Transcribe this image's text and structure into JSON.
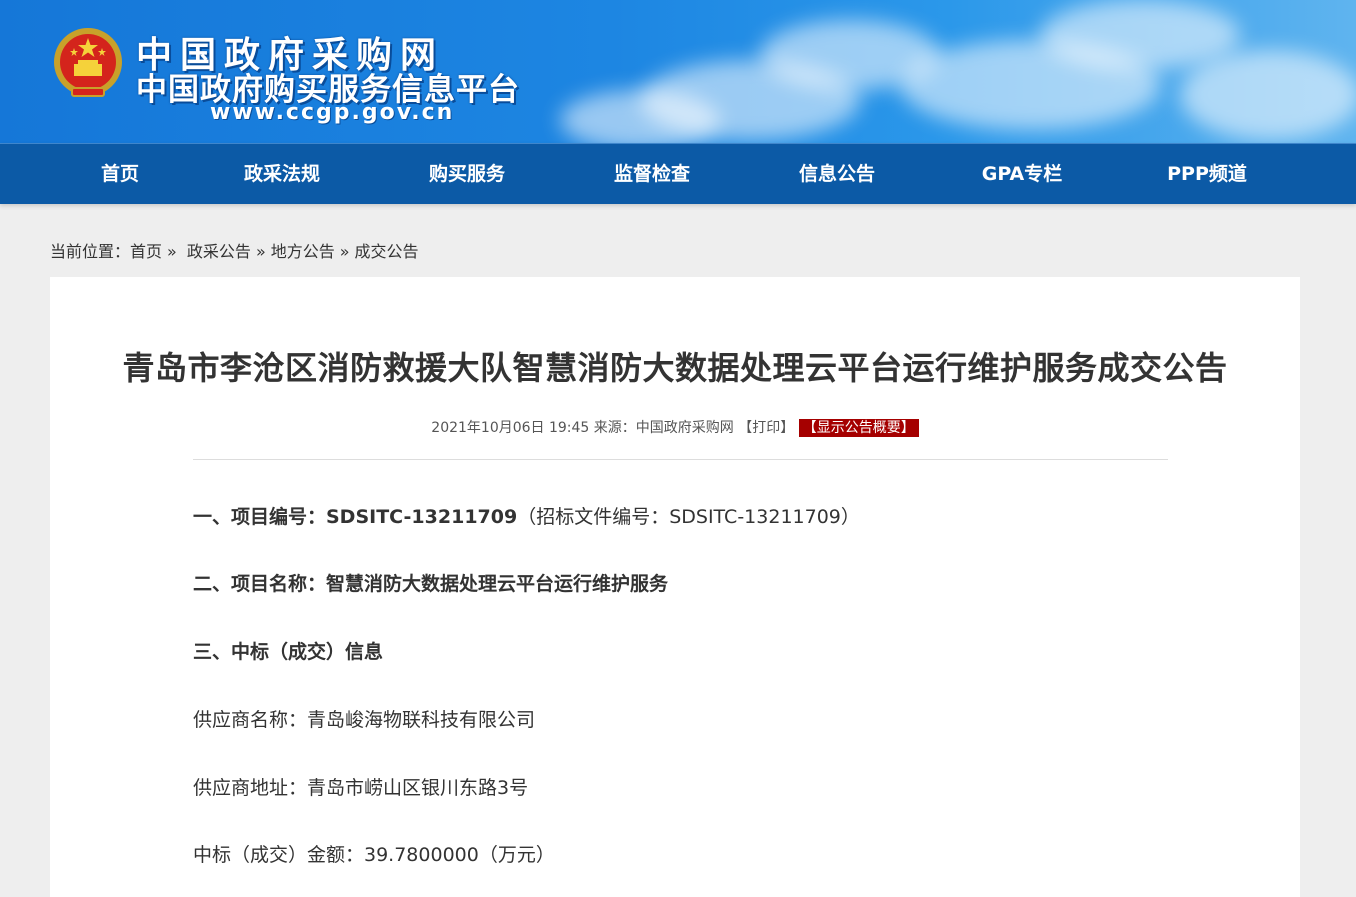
{
  "header": {
    "brand_line1": "中国政府采购网",
    "brand_line2": "中国政府购买服务信息平台",
    "brand_url": "www.ccgp.gov.cn",
    "emblem_icon": "national-emblem-icon",
    "colors": {
      "header_blue": "#1d86e2",
      "nav_blue": "#0c5aa6",
      "summary_red": "#a50000"
    }
  },
  "nav": {
    "items": [
      {
        "label": "首页"
      },
      {
        "label": "政采法规"
      },
      {
        "label": "购买服务"
      },
      {
        "label": "监督检查"
      },
      {
        "label": "信息公告"
      },
      {
        "label": "GPA专栏"
      },
      {
        "label": "PPP频道"
      }
    ]
  },
  "breadcrumb": {
    "prefix": "当前位置：",
    "items": [
      "首页",
      "政采公告",
      "地方公告",
      "成交公告"
    ],
    "separator": "»"
  },
  "article": {
    "title": "青岛市李沧区消防救援大队智慧消防大数据处理云平台运行维护服务成交公告",
    "meta": {
      "datetime": "2021年10月06日 19:45",
      "source_label": "来源：",
      "source": "中国政府采购网",
      "print": "【打印】",
      "summary": "【显示公告概要】"
    },
    "sections": {
      "project_no_label": "一、项目编号：SDSITC-13211709",
      "project_no_extra": "（招标文件编号：SDSITC-13211709）",
      "project_name": "二、项目名称：智慧消防大数据处理云平台运行维护服务",
      "award_info": "三、中标（成交）信息",
      "supplier_name": "供应商名称：青岛峻海物联科技有限公司",
      "supplier_address": "供应商地址：青岛市崂山区银川东路3号",
      "amount": "中标（成交）金额：39.7800000（万元）"
    }
  }
}
